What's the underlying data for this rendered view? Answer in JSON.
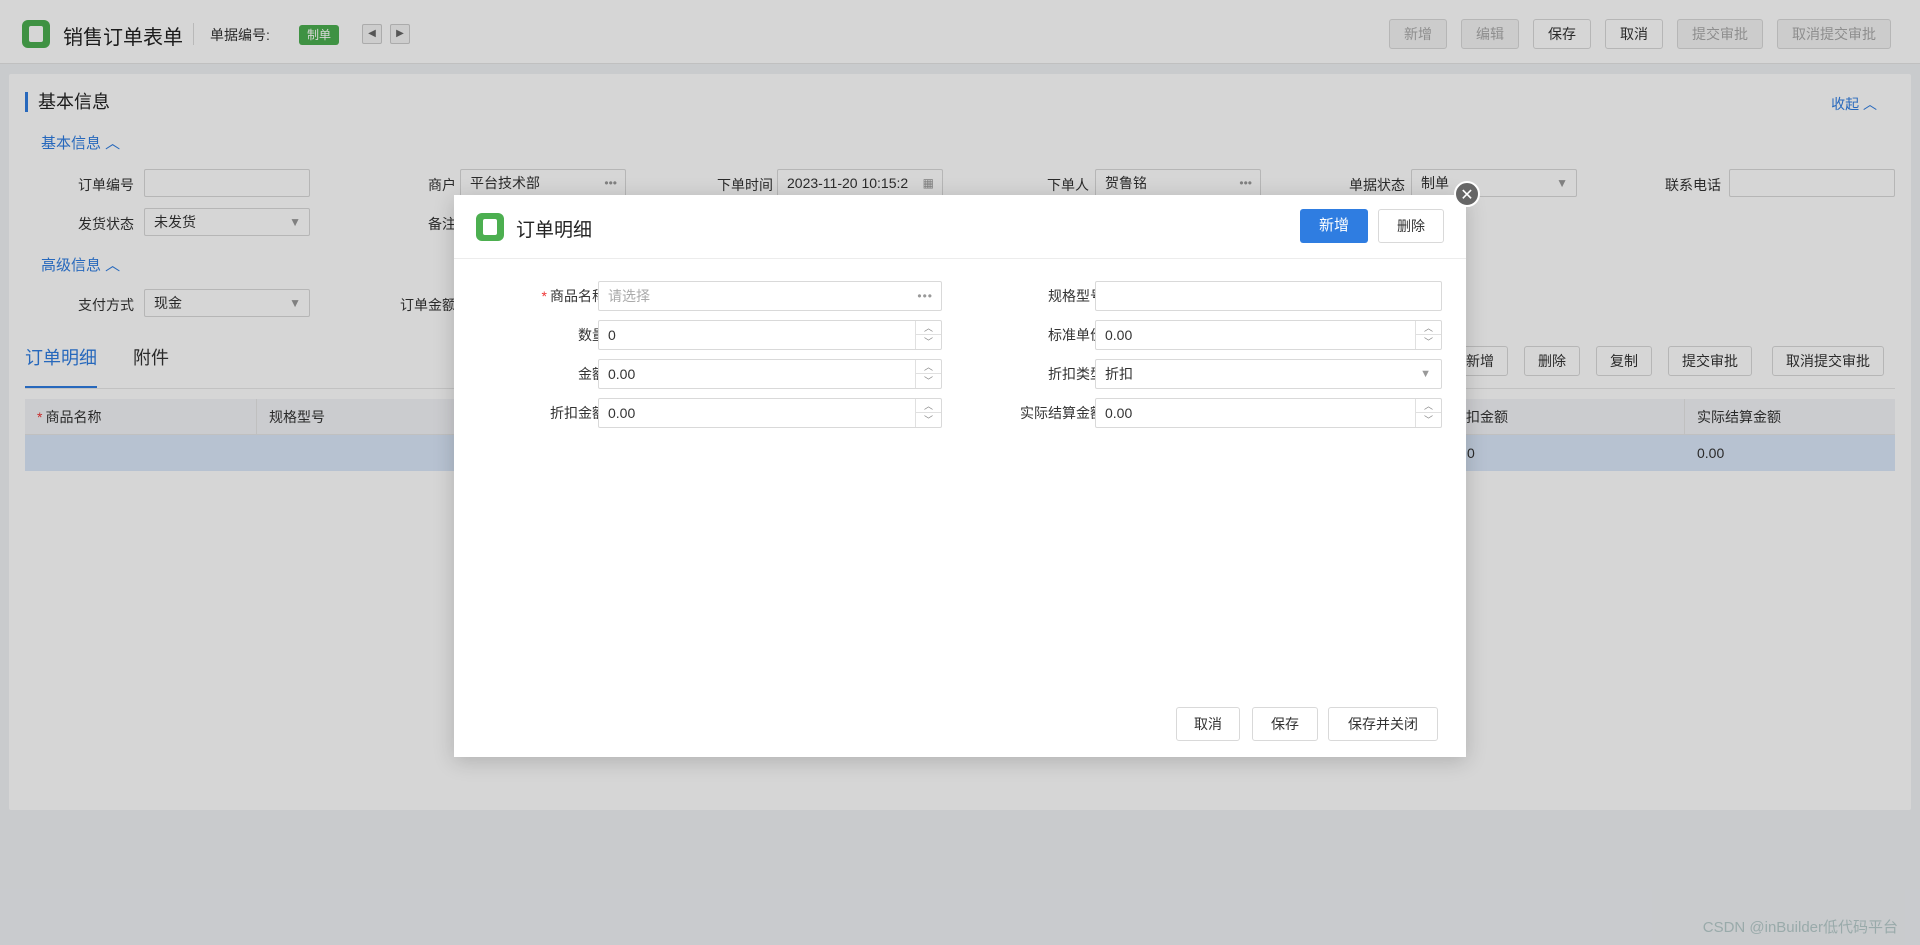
{
  "header": {
    "title": "销售订单表单",
    "bill_no_label": "单据编号:",
    "status_badge": "制单",
    "prev_icon": "◀",
    "next_icon": "▶",
    "buttons": [
      "新增",
      "编辑",
      "保存",
      "取消",
      "提交审批",
      "取消提交审批"
    ]
  },
  "section": {
    "title": "基本信息",
    "collapse": "收起 ︿",
    "basic_group": "基本信息 ︿",
    "advanced_group": "高级信息 ︿"
  },
  "form": {
    "order_no_label": "订单编号",
    "order_no_value": "",
    "merchant_label": "商户",
    "merchant_value": "平台技术部",
    "order_time_label": "下单时间",
    "order_time_value": "2023-11-20 10:15:2",
    "orderer_label": "下单人",
    "orderer_value": "贺鲁铭",
    "bill_status_label": "单据状态",
    "bill_status_value": "制单",
    "phone_label": "联系电话",
    "phone_value": "",
    "ship_status_label": "发货状态",
    "ship_status_value": "未发货",
    "remark_label": "备注",
    "pay_method_label": "支付方式",
    "pay_method_value": "现金",
    "order_amount_label": "订单金额"
  },
  "tabs": [
    "订单明细",
    "附件"
  ],
  "grid_buttons": [
    "新增",
    "删除",
    "复制",
    "提交审批",
    "取消提交审批"
  ],
  "grid": {
    "columns": [
      "商品名称",
      "规格型号",
      "扣金额",
      "实际结算金额"
    ],
    "row": [
      "",
      "",
      "0",
      "0.00"
    ]
  },
  "dialog": {
    "title": "订单明细",
    "add_button": "新增",
    "delete_button": "删除",
    "close_icon": "✕",
    "fields": {
      "product_label": "商品名称",
      "product_placeholder": "请选择",
      "spec_label": "规格型号",
      "spec_value": "",
      "qty_label": "数量",
      "qty_value": "0",
      "unit_price_label": "标准单价",
      "unit_price_value": "0.00",
      "amount_label": "金额",
      "amount_value": "0.00",
      "discount_type_label": "折扣类型",
      "discount_type_value": "折扣",
      "discount_amount_label": "折扣金额",
      "discount_amount_value": "0.00",
      "settle_amount_label": "实际结算金额",
      "settle_amount_value": "0.00"
    },
    "footer": {
      "cancel": "取消",
      "save": "保存",
      "save_close": "保存并关闭"
    }
  },
  "watermark": "CSDN @inBuilder低代码平台",
  "colors": {
    "primary": "#2f7de1",
    "brand_green": "#4caf50",
    "required": "#e33"
  }
}
